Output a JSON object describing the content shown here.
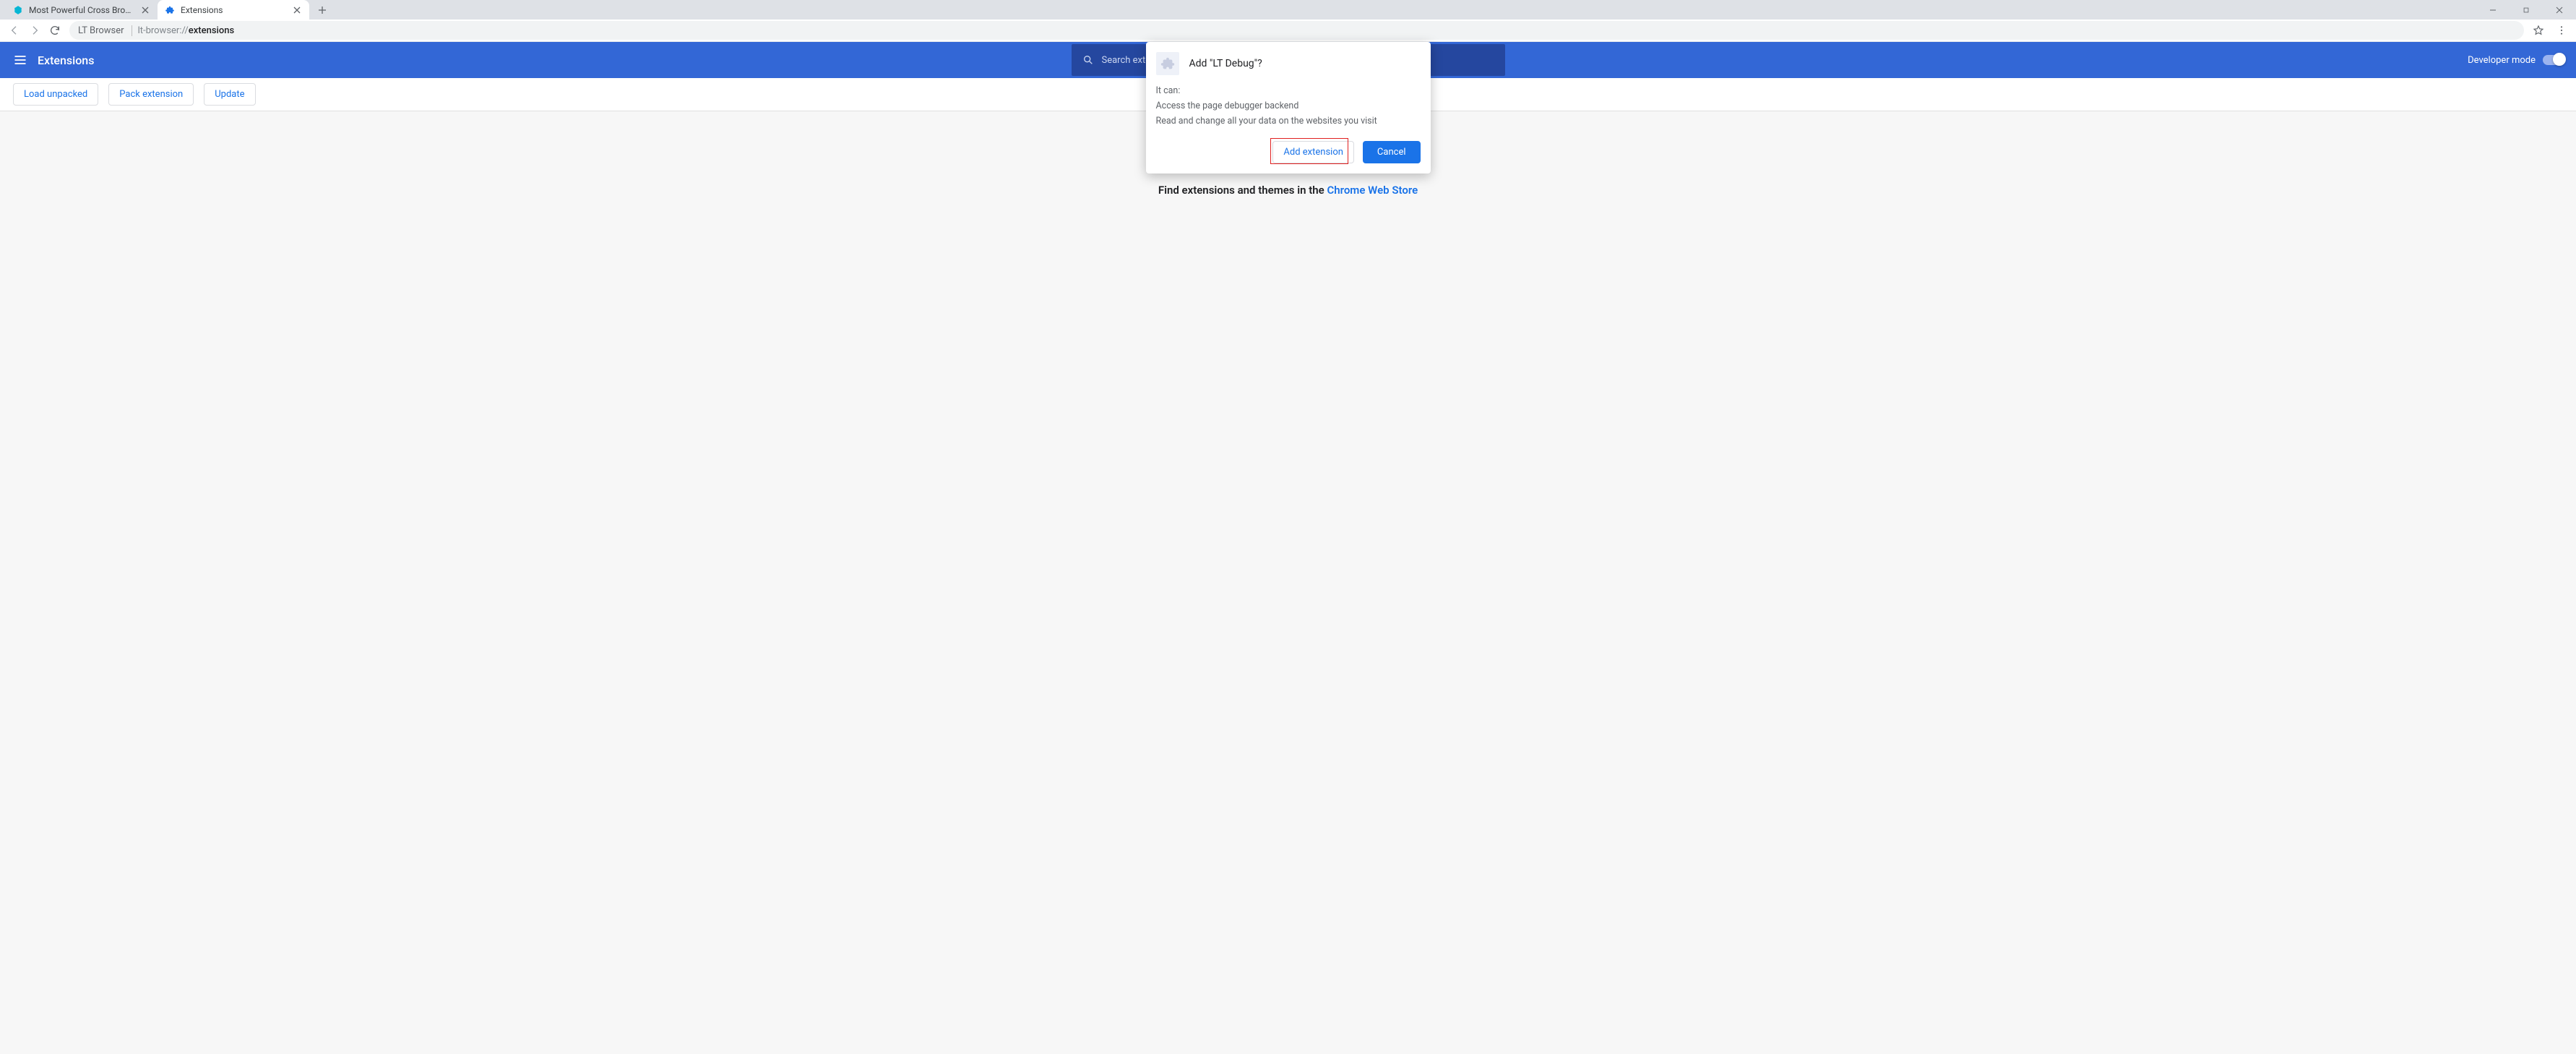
{
  "tabs": [
    {
      "title": "Most Powerful Cross Browser Tes"
    },
    {
      "title": "Extensions"
    }
  ],
  "omnibox": {
    "prefix": "LT Browser",
    "url_light": "lt-browser://",
    "url_bold": "extensions"
  },
  "ext_header": {
    "title": "Extensions",
    "search_placeholder": "Search exte",
    "developer_mode": "Developer mode"
  },
  "actions": {
    "load_unpacked": "Load unpacked",
    "pack_extension": "Pack extension",
    "update": "Update"
  },
  "store_line": {
    "prefix": "Find extensions and themes in the ",
    "link": "Chrome Web Store"
  },
  "dialog": {
    "title": "Add \"LT Debug\"?",
    "it_can": "It can:",
    "perm1": "Access the page debugger backend",
    "perm2": "Read and change all your data on the websites you visit",
    "add": "Add extension",
    "cancel": "Cancel"
  }
}
